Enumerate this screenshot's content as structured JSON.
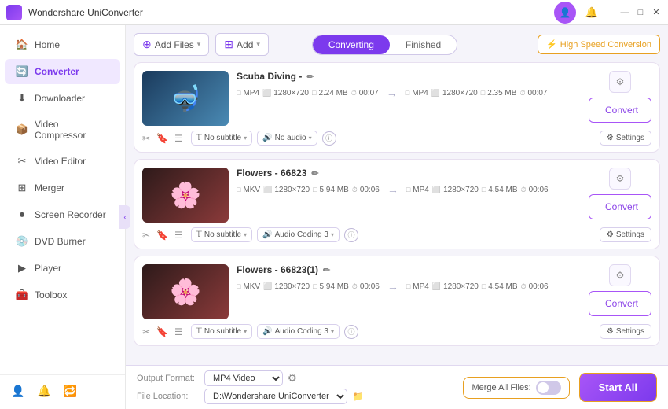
{
  "titlebar": {
    "title": "Wondershare UniConverter",
    "controls": [
      "profile-icon",
      "bell-icon",
      "minimize",
      "maximize",
      "close"
    ]
  },
  "sidebar": {
    "items": [
      {
        "id": "home",
        "label": "Home",
        "icon": "🏠",
        "active": false
      },
      {
        "id": "converter",
        "label": "Converter",
        "icon": "🔄",
        "active": true
      },
      {
        "id": "downloader",
        "label": "Downloader",
        "icon": "⬇",
        "active": false
      },
      {
        "id": "video-compressor",
        "label": "Video Compressor",
        "icon": "📦",
        "active": false
      },
      {
        "id": "video-editor",
        "label": "Video Editor",
        "icon": "✂",
        "active": false
      },
      {
        "id": "merger",
        "label": "Merger",
        "icon": "⊞",
        "active": false
      },
      {
        "id": "screen-recorder",
        "label": "Screen Recorder",
        "icon": "⏺",
        "active": false
      },
      {
        "id": "dvd-burner",
        "label": "DVD Burner",
        "icon": "💿",
        "active": false
      },
      {
        "id": "player",
        "label": "Player",
        "icon": "▶",
        "active": false
      },
      {
        "id": "toolbox",
        "label": "Toolbox",
        "icon": "🧰",
        "active": false
      }
    ],
    "bottom_items": [
      {
        "id": "profile",
        "icon": "👤"
      },
      {
        "id": "bell",
        "icon": "🔔"
      },
      {
        "id": "refresh",
        "icon": "🔁"
      }
    ]
  },
  "toolbar": {
    "add_file_label": "Add Files",
    "add_label": "Add",
    "tab_converting": "Converting",
    "tab_finished": "Finished",
    "speed_label": "High Speed Conversion"
  },
  "files": [
    {
      "id": "file1",
      "title": "Scuba Diving -",
      "thumb_type": "ocean",
      "src_format": "MP4",
      "src_res": "1280×720",
      "src_size": "2.24 MB",
      "src_duration": "00:07",
      "dst_format": "MP4",
      "dst_res": "1280×720",
      "dst_size": "2.35 MB",
      "dst_duration": "00:07",
      "subtitle": "No subtitle",
      "audio": "No audio"
    },
    {
      "id": "file2",
      "title": "Flowers - 66823",
      "thumb_type": "flowers",
      "src_format": "MKV",
      "src_res": "1280×720",
      "src_size": "5.94 MB",
      "src_duration": "00:06",
      "dst_format": "MP4",
      "dst_res": "1280×720",
      "dst_size": "4.54 MB",
      "dst_duration": "00:06",
      "subtitle": "No subtitle",
      "audio": "Audio Coding 3"
    },
    {
      "id": "file3",
      "title": "Flowers - 66823(1)",
      "thumb_type": "flowers",
      "src_format": "MKV",
      "src_res": "1280×720",
      "src_size": "5.94 MB",
      "src_duration": "00:06",
      "dst_format": "MP4",
      "dst_res": "1280×720",
      "dst_size": "4.54 MB",
      "dst_duration": "00:06",
      "subtitle": "No subtitle",
      "audio": "Audio Coding 3"
    }
  ],
  "bottom": {
    "output_format_label": "Output Format:",
    "output_format_value": "MP4 Video",
    "file_location_label": "File Location:",
    "file_location_value": "D:\\Wondershare UniConverter",
    "merge_label": "Merge All Files:",
    "start_label": "Start All"
  }
}
